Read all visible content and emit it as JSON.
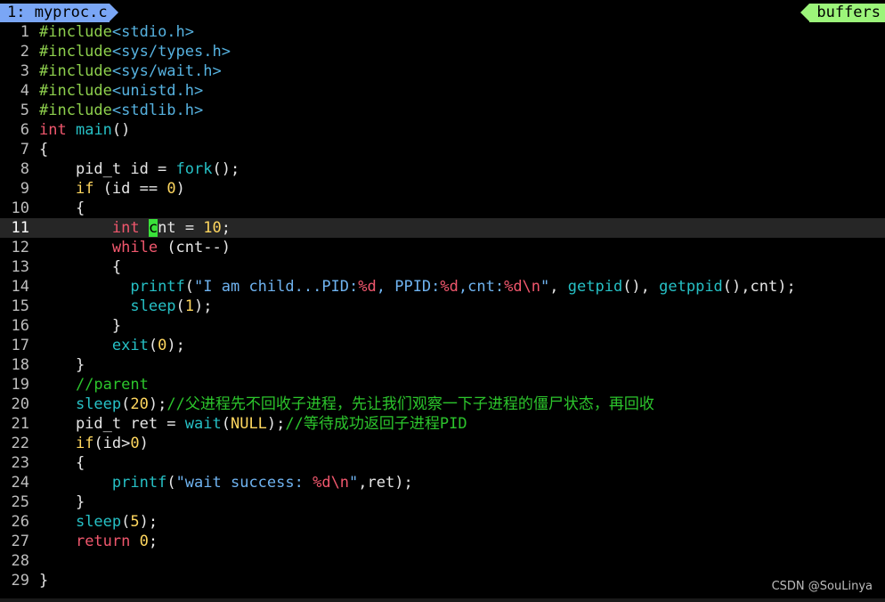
{
  "tab": {
    "label": "1: myproc.c"
  },
  "buffers_label": "buffers",
  "colors": {
    "background": "#000000",
    "tab_active": "#7aa6f5",
    "buffers_tag": "#9cf57a",
    "cursorline": "#262626",
    "cursor": "#3ae23a",
    "preproc": "#8ed04d",
    "include_path": "#56b2e0",
    "keyword": "#f0576d",
    "function": "#26c0c5",
    "number": "#ffd75f",
    "string": "#6fb3f0",
    "format": "#f0576d",
    "comment": "#2cc52c",
    "text": "#e6e6e6"
  },
  "watermark": "CSDN @SouLinya",
  "lines": [
    {
      "n": "1",
      "toks": [
        [
          "#include",
          "pp"
        ],
        [
          "<stdio.h>",
          "inc"
        ]
      ]
    },
    {
      "n": "2",
      "toks": [
        [
          "#include",
          "pp"
        ],
        [
          "<sys/types.h>",
          "inc"
        ]
      ]
    },
    {
      "n": "3",
      "toks": [
        [
          "#include",
          "pp"
        ],
        [
          "<sys/wait.h>",
          "inc"
        ]
      ]
    },
    {
      "n": "4",
      "toks": [
        [
          "#include",
          "pp"
        ],
        [
          "<unistd.h>",
          "inc"
        ]
      ]
    },
    {
      "n": "5",
      "toks": [
        [
          "#include",
          "pp"
        ],
        [
          "<stdlib.h>",
          "inc"
        ]
      ]
    },
    {
      "n": "6",
      "toks": [
        [
          "int",
          "kw"
        ],
        [
          " ",
          ""
        ],
        [
          "main",
          "fn"
        ],
        [
          "()",
          ""
        ]
      ]
    },
    {
      "n": "7",
      "toks": [
        [
          "{",
          ""
        ]
      ]
    },
    {
      "n": "8",
      "toks": [
        [
          "    pid_t id = ",
          ""
        ],
        [
          "fork",
          "fn"
        ],
        [
          "();",
          ""
        ]
      ]
    },
    {
      "n": "9",
      "toks": [
        [
          "    ",
          ""
        ],
        [
          "if",
          "num"
        ],
        [
          " (id == ",
          ""
        ],
        [
          "0",
          "num"
        ],
        [
          ")",
          ""
        ]
      ]
    },
    {
      "n": "10",
      "toks": [
        [
          "    {",
          ""
        ]
      ]
    },
    {
      "n": "11",
      "current": true,
      "toks": [
        [
          "        ",
          ""
        ],
        [
          "int",
          "kw"
        ],
        [
          " ",
          ""
        ],
        [
          "c",
          "cursor"
        ],
        [
          "nt = ",
          ""
        ],
        [
          "10",
          "num"
        ],
        [
          ";",
          ""
        ]
      ]
    },
    {
      "n": "12",
      "toks": [
        [
          "        ",
          ""
        ],
        [
          "while",
          "kw"
        ],
        [
          " (cnt--)",
          ""
        ]
      ]
    },
    {
      "n": "13",
      "toks": [
        [
          "        {",
          ""
        ]
      ]
    },
    {
      "n": "14",
      "toks": [
        [
          "          ",
          ""
        ],
        [
          "printf",
          "fn"
        ],
        [
          "(",
          ""
        ],
        [
          "\"I am child...PID:",
          "str"
        ],
        [
          "%d",
          "fmt"
        ],
        [
          ", PPID:",
          "str"
        ],
        [
          "%d",
          "fmt"
        ],
        [
          ",cnt:",
          "str"
        ],
        [
          "%d\\n",
          "fmt"
        ],
        [
          "\"",
          "str"
        ],
        [
          ", ",
          ""
        ],
        [
          "getpid",
          "fn"
        ],
        [
          "(), ",
          ""
        ],
        [
          "getppid",
          "fn"
        ],
        [
          "(),cnt);",
          ""
        ]
      ]
    },
    {
      "n": "15",
      "toks": [
        [
          "          ",
          ""
        ],
        [
          "sleep",
          "fn"
        ],
        [
          "(",
          ""
        ],
        [
          "1",
          "num"
        ],
        [
          ");",
          ""
        ]
      ]
    },
    {
      "n": "16",
      "toks": [
        [
          "        }",
          ""
        ]
      ]
    },
    {
      "n": "17",
      "toks": [
        [
          "        ",
          ""
        ],
        [
          "exit",
          "fn"
        ],
        [
          "(",
          ""
        ],
        [
          "0",
          "num"
        ],
        [
          ");",
          ""
        ]
      ]
    },
    {
      "n": "18",
      "toks": [
        [
          "    }",
          ""
        ]
      ]
    },
    {
      "n": "19",
      "toks": [
        [
          "    ",
          ""
        ],
        [
          "//parent",
          "cm"
        ]
      ]
    },
    {
      "n": "20",
      "toks": [
        [
          "    ",
          ""
        ],
        [
          "sleep",
          "fn"
        ],
        [
          "(",
          ""
        ],
        [
          "20",
          "num"
        ],
        [
          ");",
          ""
        ],
        [
          "//父进程先不回收子进程，先让我们观察一下子进程的僵尸状态，再回收",
          "cm"
        ]
      ]
    },
    {
      "n": "21",
      "toks": [
        [
          "    pid_t ret = ",
          ""
        ],
        [
          "wait",
          "fn"
        ],
        [
          "(",
          ""
        ],
        [
          "NULL",
          "num"
        ],
        [
          ");",
          ""
        ],
        [
          "//等待成功返回子进程PID",
          "cm"
        ]
      ]
    },
    {
      "n": "22",
      "toks": [
        [
          "    ",
          ""
        ],
        [
          "if",
          "num"
        ],
        [
          "(id>",
          ""
        ],
        [
          "0",
          "num"
        ],
        [
          ")",
          ""
        ]
      ]
    },
    {
      "n": "23",
      "toks": [
        [
          "    {",
          ""
        ]
      ]
    },
    {
      "n": "24",
      "toks": [
        [
          "        ",
          ""
        ],
        [
          "printf",
          "fn"
        ],
        [
          "(",
          ""
        ],
        [
          "\"wait success: ",
          "str"
        ],
        [
          "%d\\n",
          "fmt"
        ],
        [
          "\"",
          "str"
        ],
        [
          ",ret);",
          ""
        ]
      ]
    },
    {
      "n": "25",
      "toks": [
        [
          "    }",
          ""
        ]
      ]
    },
    {
      "n": "26",
      "toks": [
        [
          "    ",
          ""
        ],
        [
          "sleep",
          "fn"
        ],
        [
          "(",
          ""
        ],
        [
          "5",
          "num"
        ],
        [
          ");",
          ""
        ]
      ]
    },
    {
      "n": "27",
      "toks": [
        [
          "    ",
          ""
        ],
        [
          "return",
          "kw"
        ],
        [
          " ",
          ""
        ],
        [
          "0",
          "num"
        ],
        [
          ";",
          ""
        ]
      ]
    },
    {
      "n": "28",
      "toks": []
    },
    {
      "n": "29",
      "toks": [
        [
          "}",
          ""
        ]
      ]
    }
  ]
}
